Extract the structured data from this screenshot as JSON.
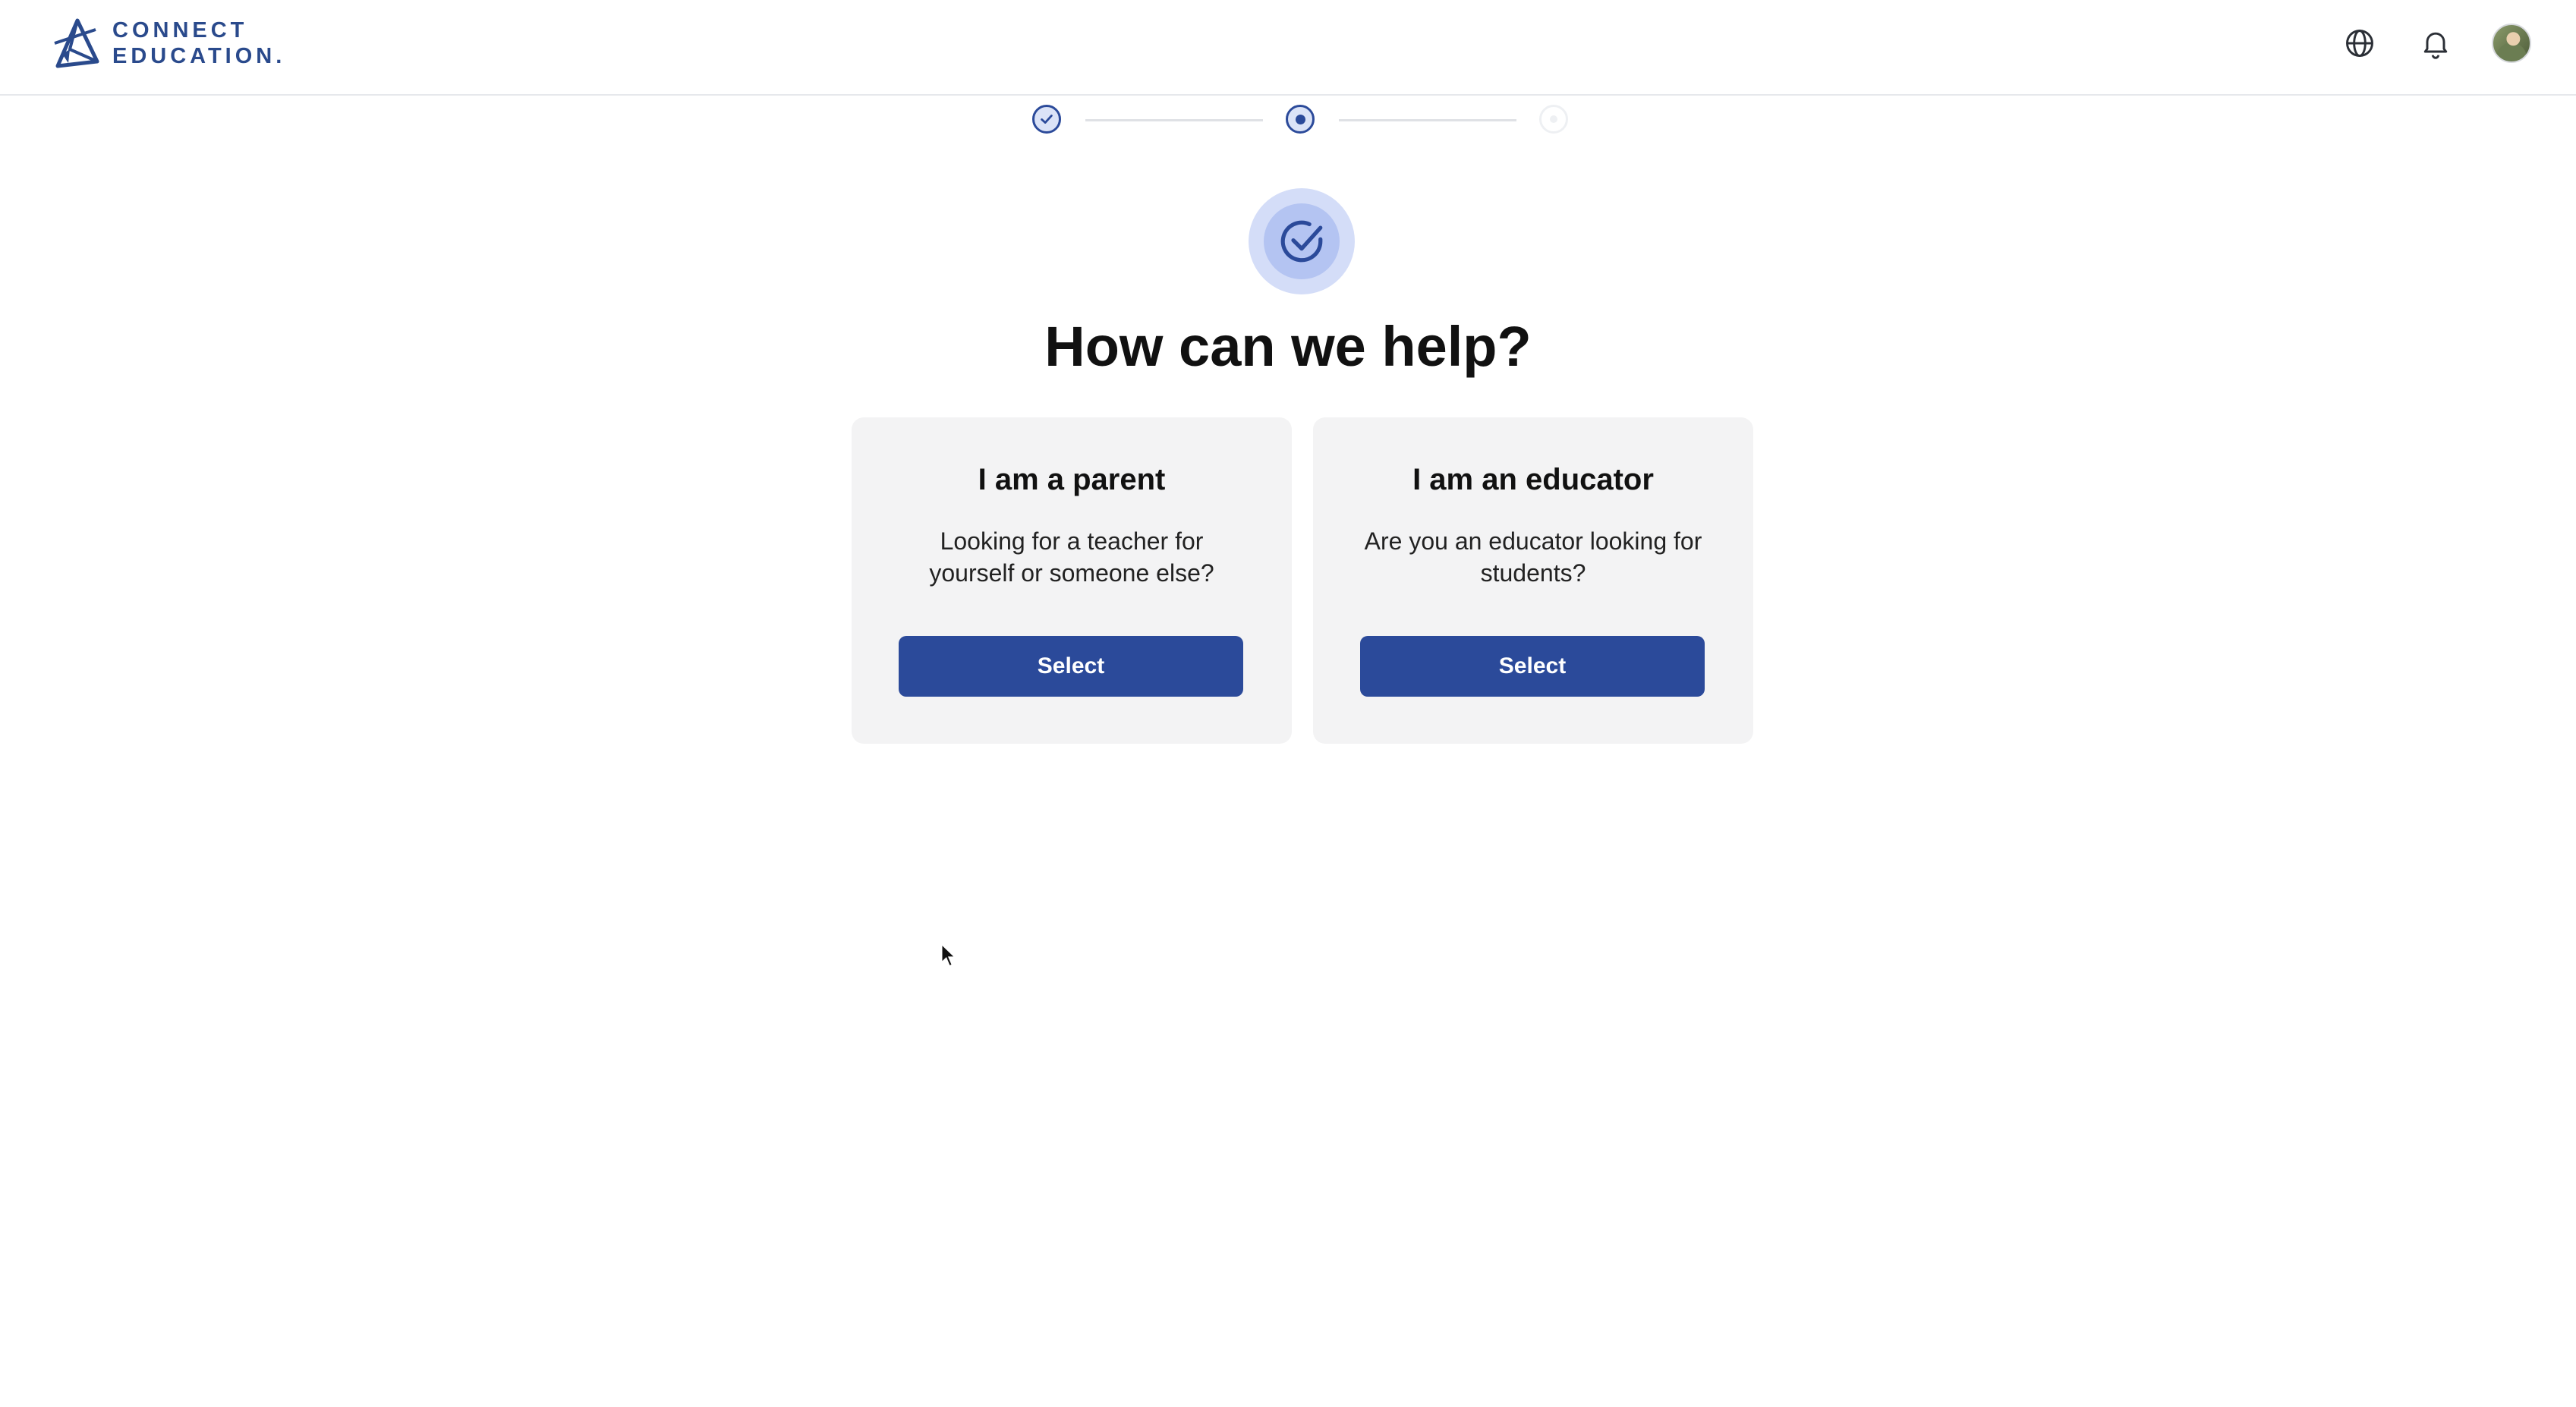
{
  "brand": {
    "line1": "CONNECT",
    "line2": "EDUCATION.",
    "color": "#2a4a8c"
  },
  "header": {
    "icons": [
      "globe-icon",
      "bell-icon",
      "user-avatar"
    ]
  },
  "stepper": {
    "steps": [
      {
        "state": "completed"
      },
      {
        "state": "active"
      },
      {
        "state": "upcoming"
      }
    ]
  },
  "hero": {
    "icon": "check-circle-icon",
    "title": "How can we help?"
  },
  "options": [
    {
      "title": "I am a parent",
      "description": "Looking for a teacher for yourself or someone else?",
      "button": "Select"
    },
    {
      "title": "I am an educator",
      "description": "Are you an educator looking for students?",
      "button": "Select"
    }
  ],
  "colors": {
    "primary": "#2b4a9a",
    "card_bg": "#f3f3f4",
    "hero_outer": "#d4ddf8",
    "hero_inner": "#b4c4f2"
  }
}
